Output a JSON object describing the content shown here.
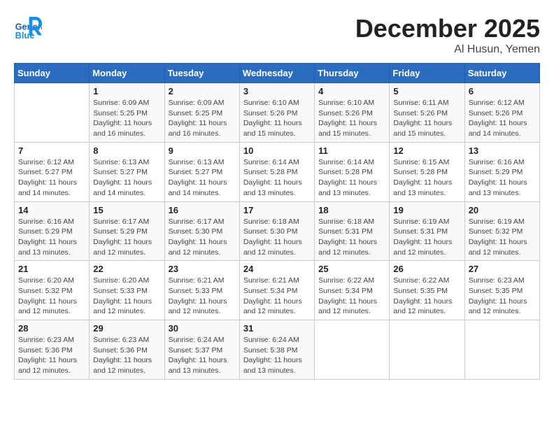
{
  "logo": {
    "general": "General",
    "blue": "Blue"
  },
  "title": "December 2025",
  "location": "Al Husun, Yemen",
  "days_of_week": [
    "Sunday",
    "Monday",
    "Tuesday",
    "Wednesday",
    "Thursday",
    "Friday",
    "Saturday"
  ],
  "weeks": [
    [
      {
        "day": "",
        "info": ""
      },
      {
        "day": "1",
        "info": "Sunrise: 6:09 AM\nSunset: 5:25 PM\nDaylight: 11 hours\nand 16 minutes."
      },
      {
        "day": "2",
        "info": "Sunrise: 6:09 AM\nSunset: 5:25 PM\nDaylight: 11 hours\nand 16 minutes."
      },
      {
        "day": "3",
        "info": "Sunrise: 6:10 AM\nSunset: 5:26 PM\nDaylight: 11 hours\nand 15 minutes."
      },
      {
        "day": "4",
        "info": "Sunrise: 6:10 AM\nSunset: 5:26 PM\nDaylight: 11 hours\nand 15 minutes."
      },
      {
        "day": "5",
        "info": "Sunrise: 6:11 AM\nSunset: 5:26 PM\nDaylight: 11 hours\nand 15 minutes."
      },
      {
        "day": "6",
        "info": "Sunrise: 6:12 AM\nSunset: 5:26 PM\nDaylight: 11 hours\nand 14 minutes."
      }
    ],
    [
      {
        "day": "7",
        "info": "Sunrise: 6:12 AM\nSunset: 5:27 PM\nDaylight: 11 hours\nand 14 minutes."
      },
      {
        "day": "8",
        "info": "Sunrise: 6:13 AM\nSunset: 5:27 PM\nDaylight: 11 hours\nand 14 minutes."
      },
      {
        "day": "9",
        "info": "Sunrise: 6:13 AM\nSunset: 5:27 PM\nDaylight: 11 hours\nand 14 minutes."
      },
      {
        "day": "10",
        "info": "Sunrise: 6:14 AM\nSunset: 5:28 PM\nDaylight: 11 hours\nand 13 minutes."
      },
      {
        "day": "11",
        "info": "Sunrise: 6:14 AM\nSunset: 5:28 PM\nDaylight: 11 hours\nand 13 minutes."
      },
      {
        "day": "12",
        "info": "Sunrise: 6:15 AM\nSunset: 5:28 PM\nDaylight: 11 hours\nand 13 minutes."
      },
      {
        "day": "13",
        "info": "Sunrise: 6:16 AM\nSunset: 5:29 PM\nDaylight: 11 hours\nand 13 minutes."
      }
    ],
    [
      {
        "day": "14",
        "info": "Sunrise: 6:16 AM\nSunset: 5:29 PM\nDaylight: 11 hours\nand 13 minutes."
      },
      {
        "day": "15",
        "info": "Sunrise: 6:17 AM\nSunset: 5:29 PM\nDaylight: 11 hours\nand 12 minutes."
      },
      {
        "day": "16",
        "info": "Sunrise: 6:17 AM\nSunset: 5:30 PM\nDaylight: 11 hours\nand 12 minutes."
      },
      {
        "day": "17",
        "info": "Sunrise: 6:18 AM\nSunset: 5:30 PM\nDaylight: 11 hours\nand 12 minutes."
      },
      {
        "day": "18",
        "info": "Sunrise: 6:18 AM\nSunset: 5:31 PM\nDaylight: 11 hours\nand 12 minutes."
      },
      {
        "day": "19",
        "info": "Sunrise: 6:19 AM\nSunset: 5:31 PM\nDaylight: 11 hours\nand 12 minutes."
      },
      {
        "day": "20",
        "info": "Sunrise: 6:19 AM\nSunset: 5:32 PM\nDaylight: 11 hours\nand 12 minutes."
      }
    ],
    [
      {
        "day": "21",
        "info": "Sunrise: 6:20 AM\nSunset: 5:32 PM\nDaylight: 11 hours\nand 12 minutes."
      },
      {
        "day": "22",
        "info": "Sunrise: 6:20 AM\nSunset: 5:33 PM\nDaylight: 11 hours\nand 12 minutes."
      },
      {
        "day": "23",
        "info": "Sunrise: 6:21 AM\nSunset: 5:33 PM\nDaylight: 11 hours\nand 12 minutes."
      },
      {
        "day": "24",
        "info": "Sunrise: 6:21 AM\nSunset: 5:34 PM\nDaylight: 11 hours\nand 12 minutes."
      },
      {
        "day": "25",
        "info": "Sunrise: 6:22 AM\nSunset: 5:34 PM\nDaylight: 11 hours\nand 12 minutes."
      },
      {
        "day": "26",
        "info": "Sunrise: 6:22 AM\nSunset: 5:35 PM\nDaylight: 11 hours\nand 12 minutes."
      },
      {
        "day": "27",
        "info": "Sunrise: 6:23 AM\nSunset: 5:35 PM\nDaylight: 11 hours\nand 12 minutes."
      }
    ],
    [
      {
        "day": "28",
        "info": "Sunrise: 6:23 AM\nSunset: 5:36 PM\nDaylight: 11 hours\nand 12 minutes."
      },
      {
        "day": "29",
        "info": "Sunrise: 6:23 AM\nSunset: 5:36 PM\nDaylight: 11 hours\nand 12 minutes."
      },
      {
        "day": "30",
        "info": "Sunrise: 6:24 AM\nSunset: 5:37 PM\nDaylight: 11 hours\nand 13 minutes."
      },
      {
        "day": "31",
        "info": "Sunrise: 6:24 AM\nSunset: 5:38 PM\nDaylight: 11 hours\nand 13 minutes."
      },
      {
        "day": "",
        "info": ""
      },
      {
        "day": "",
        "info": ""
      },
      {
        "day": "",
        "info": ""
      }
    ]
  ]
}
